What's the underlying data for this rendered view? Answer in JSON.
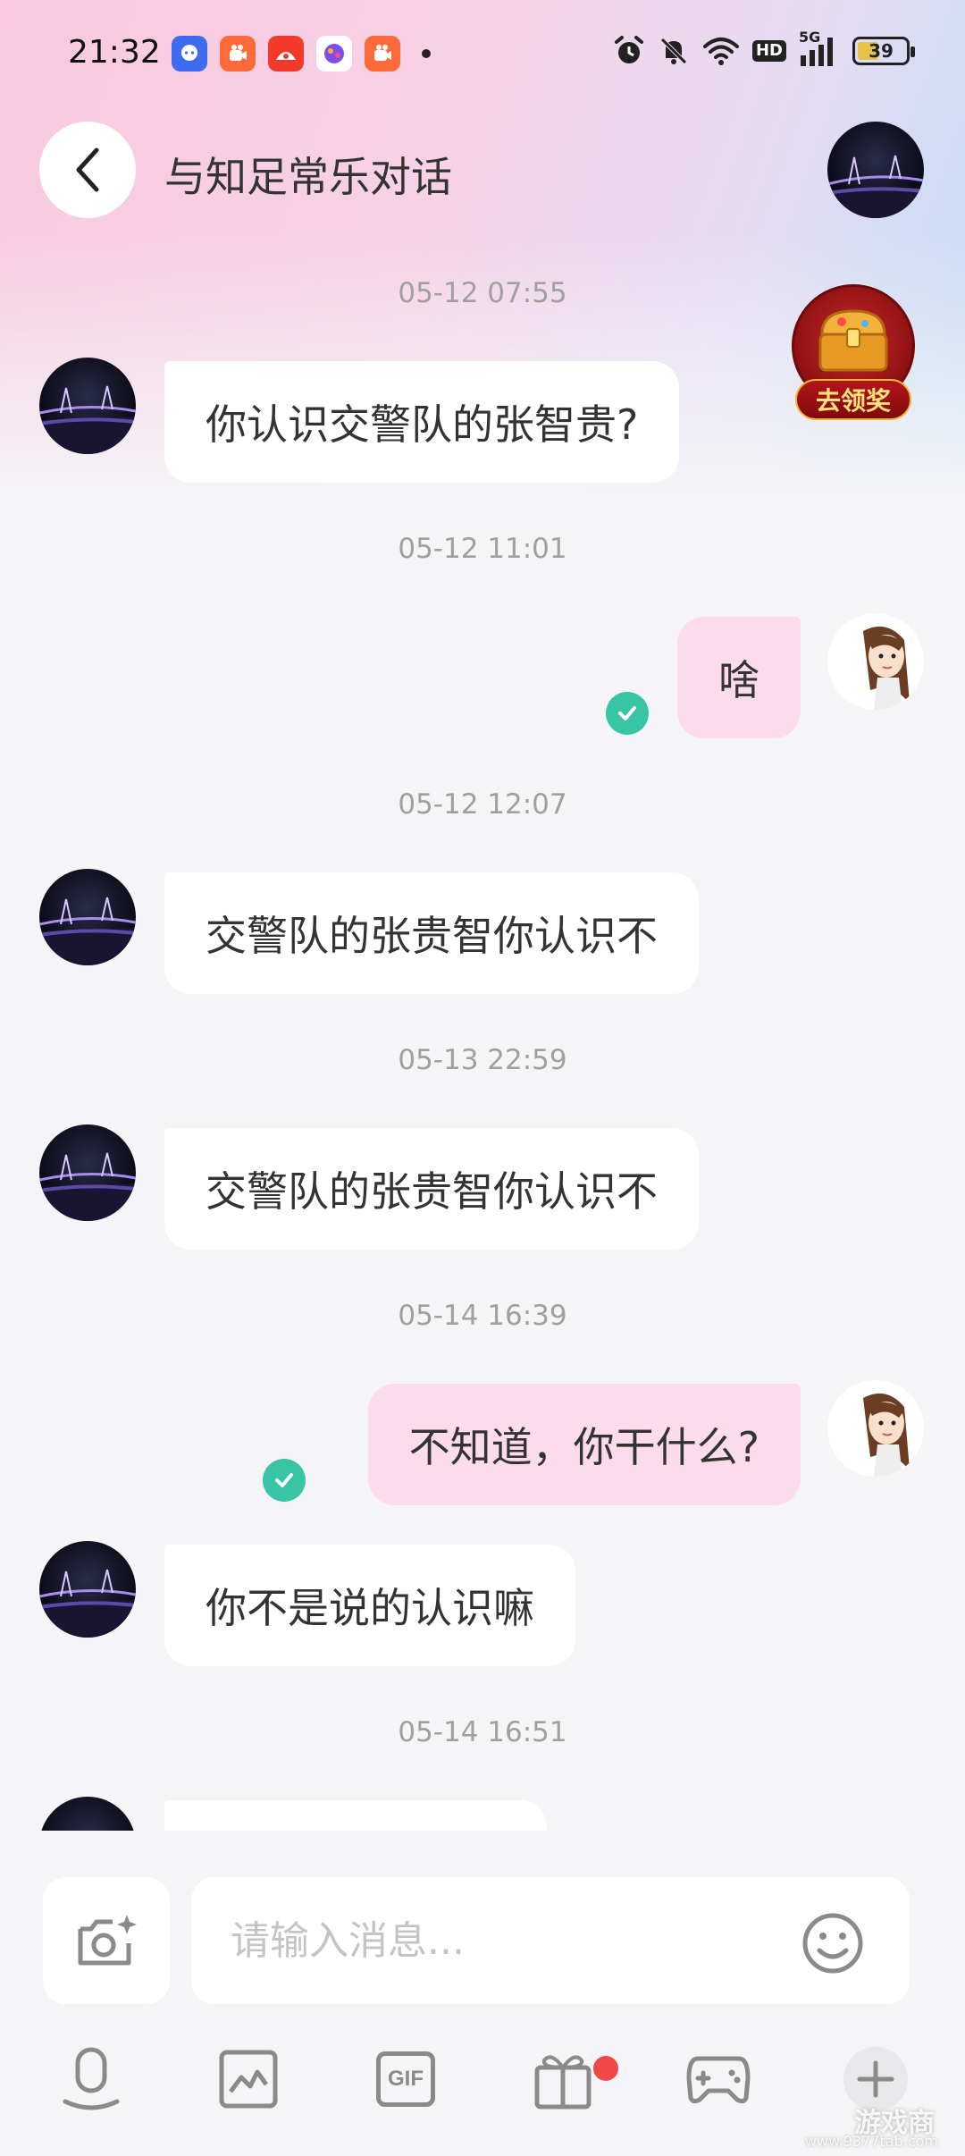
{
  "status_bar": {
    "time": "21:32",
    "network": "5G",
    "hd": "HD",
    "battery": "39"
  },
  "header": {
    "title": "与知足常乐对话"
  },
  "reward": {
    "label": "去领奖"
  },
  "messages": [
    {
      "timestamp": "05-12 07:55",
      "side": "left",
      "text": "你认识交警队的张智贵?"
    },
    {
      "timestamp": "05-12 11:01",
      "side": "right",
      "text": "啥",
      "read": true
    },
    {
      "timestamp": "05-12 12:07",
      "side": "left",
      "text": "交警队的张贵智你认识不"
    },
    {
      "timestamp": "05-13 22:59",
      "side": "left",
      "text": "交警队的张贵智你认识不"
    },
    {
      "timestamp": "05-14 16:39",
      "side": "right",
      "text": "不知道，你干什么?",
      "read": true
    },
    {
      "timestamp": "",
      "side": "left",
      "text": "你不是说的认识嘛"
    },
    {
      "timestamp": "05-14 16:51",
      "side": "left",
      "text": ""
    }
  ],
  "input": {
    "placeholder": "请输入消息..."
  },
  "toolbar": {
    "gif_label": "GIF",
    "icons": [
      "microphone-icon",
      "image-icon",
      "gif-icon",
      "gift-icon",
      "gamepad-icon",
      "plus-icon"
    ]
  },
  "watermark": {
    "text": "游戏商",
    "sub": "www.9377tab.com"
  },
  "colors": {
    "bubble_right": "#fcdcec",
    "bubble_left": "#ffffff",
    "read_check": "#37c5a5",
    "badge_dot": "#f04848"
  }
}
